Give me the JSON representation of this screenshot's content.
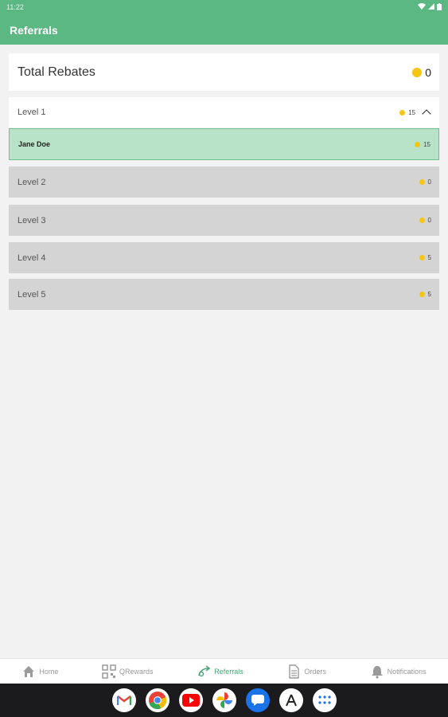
{
  "status": {
    "time": "11:22",
    "icons": [
      "wifi-icon",
      "signal-icon",
      "battery-icon"
    ]
  },
  "header": {
    "title": "Referrals",
    "color": "#5bb882"
  },
  "total": {
    "label": "Total Rebates",
    "value": "0",
    "icon": "coin-icon"
  },
  "levels": [
    {
      "label": "Level 1",
      "value": "15",
      "expanded": true,
      "members": [
        {
          "name": "Jane Doe",
          "value": "15"
        }
      ]
    },
    {
      "label": "Level 2",
      "value": "0"
    },
    {
      "label": "Level 3",
      "value": "0"
    },
    {
      "label": "Level 4",
      "value": "5"
    },
    {
      "label": "Level 5",
      "value": "5"
    }
  ],
  "bottom_nav": [
    {
      "label": "Home",
      "icon": "home-icon",
      "active": false
    },
    {
      "label": "QRewards",
      "icon": "qr-icon",
      "active": false
    },
    {
      "label": "Referrals",
      "icon": "referrals-icon",
      "active": true
    },
    {
      "label": "Orders",
      "icon": "document-icon",
      "active": false
    },
    {
      "label": "Notifications",
      "icon": "bell-icon",
      "active": false
    }
  ],
  "dock": [
    "gmail-icon",
    "chrome-icon",
    "youtube-icon",
    "photos-icon",
    "messages-icon",
    "assistant-icon",
    "app-drawer-icon"
  ],
  "colors": {
    "accent": "#5bb882",
    "coin": "#f3c614",
    "selected_row": "#b9e3c8",
    "collapsed_row": "#d4d4d5"
  }
}
